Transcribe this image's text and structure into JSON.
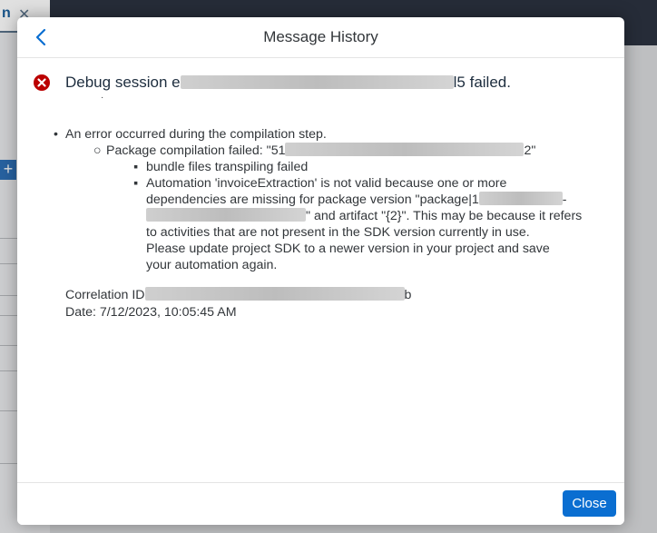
{
  "background": {
    "tab_label": "n",
    "plus_label": "+"
  },
  "dialog": {
    "title": "Message History",
    "back_icon": "chevron-left-icon",
    "error_icon": "error-circle-icon",
    "message": {
      "prefix": "Debug session e",
      "suffix": "l5 failed."
    },
    "details": {
      "level1": "An error occurred during the compilation step.",
      "level2_prefix": "Package compilation failed: \"51",
      "level2_suffix": "2\"",
      "level3_item1": "bundle files transpiling failed",
      "level3_item2_line1": "Automation 'invoiceExtraction' is not valid because one or more",
      "level3_item2_line2_prefix": "dependencies are missing for package version \"package|1",
      "level3_item2_line2_suffix": "-",
      "level3_item2_line3_suffix": "\" and artifact \"{2}\". This may be because it refers",
      "level3_item2_line4": "to activities that are not present in the SDK version currently in use.",
      "level3_item2_line5": "Please update project SDK to a newer version in your project and save",
      "level3_item2_line6": "your automation again."
    },
    "correlation_prefix": "Correlation ID",
    "correlation_suffix": "b",
    "date": "Date: 7/12/2023, 10:05:45 AM",
    "close_label": "Close"
  },
  "colors": {
    "accent": "#0a6ed1",
    "error": "#bb0000",
    "text": "#32363a"
  }
}
